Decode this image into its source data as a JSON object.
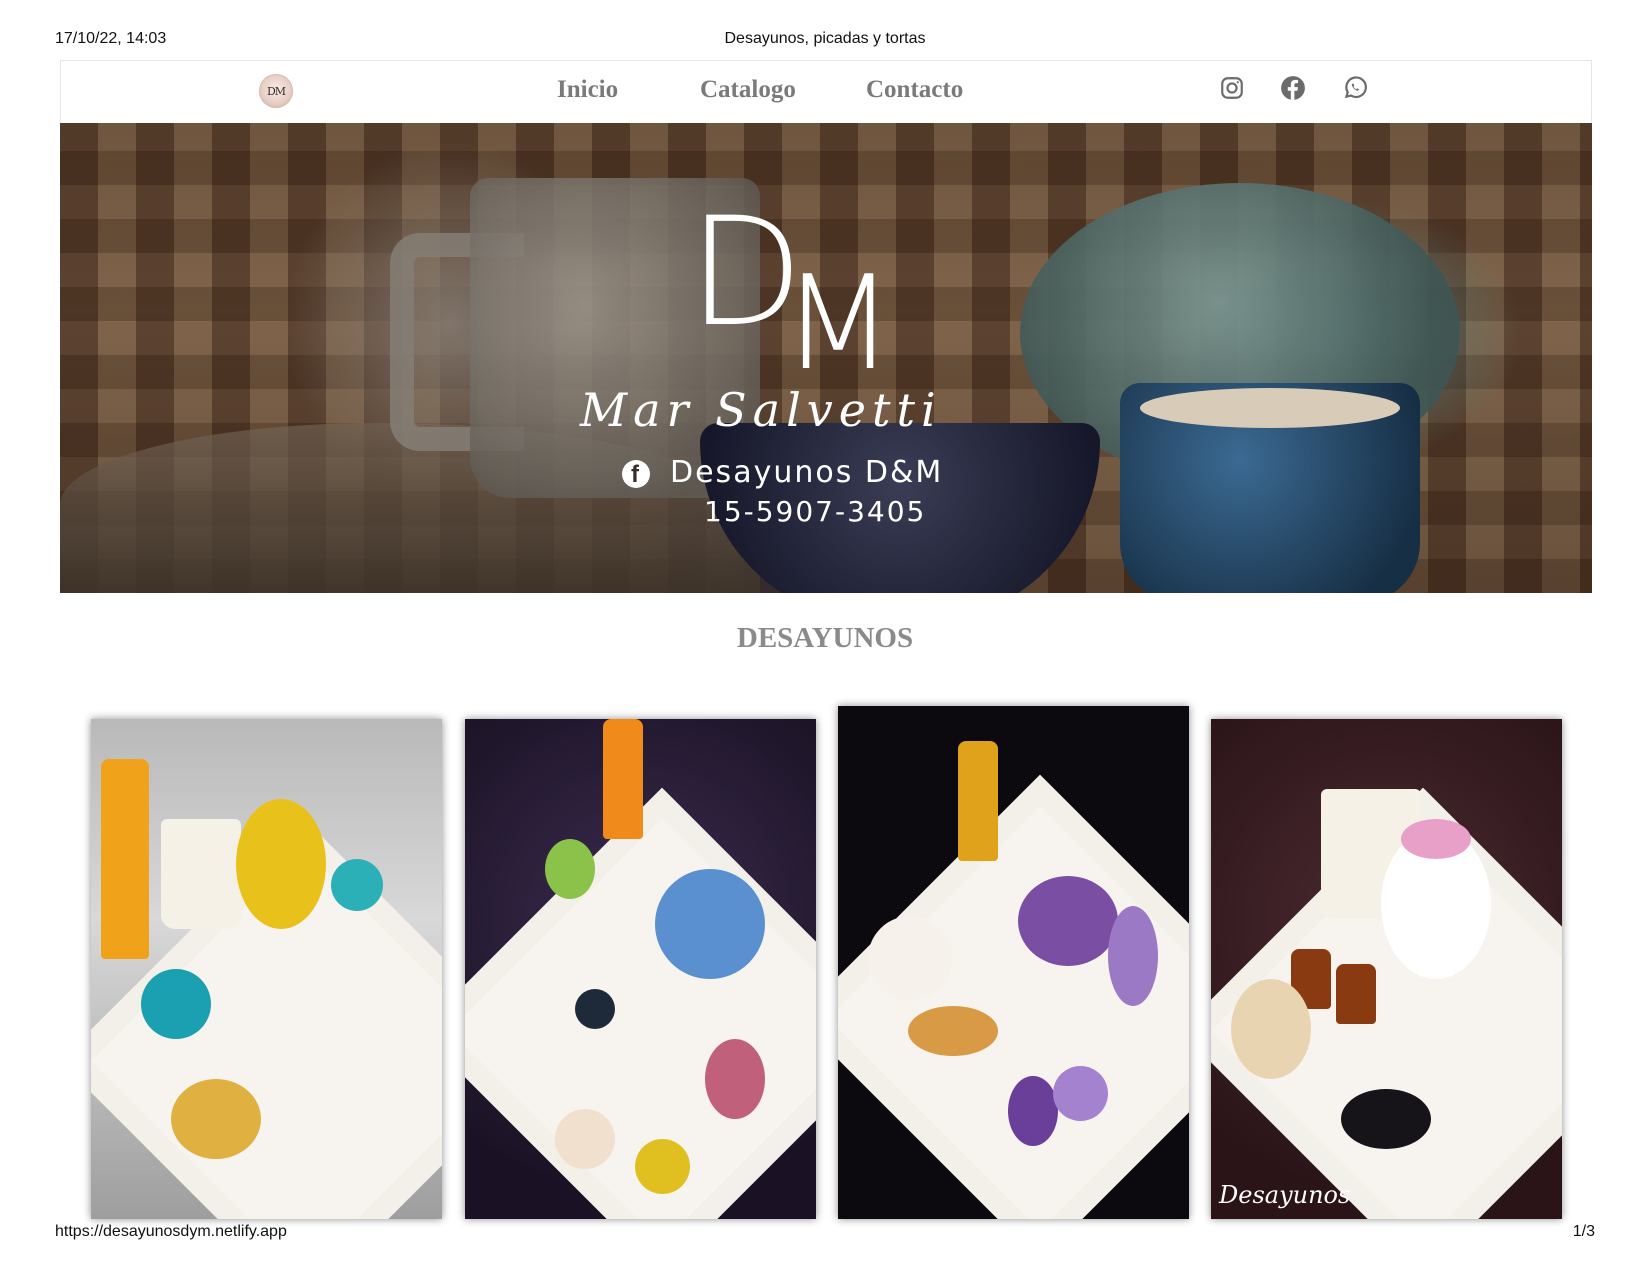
{
  "print_header": {
    "datetime": "17/10/22, 14:03",
    "title": "Desayunos, picadas y tortas"
  },
  "navbar": {
    "logo_text": "DM",
    "links": [
      {
        "label": "Inicio"
      },
      {
        "label": "Catalogo"
      },
      {
        "label": "Contacto"
      }
    ],
    "social_icons": [
      "instagram-icon",
      "facebook-icon",
      "whatsapp-icon"
    ],
    "link_color": "#7a7a7a",
    "icon_color": "#6b6b6b"
  },
  "hero": {
    "logo_letter_d": "D",
    "logo_letter_m": "M",
    "script_name": "Mar Salvetti",
    "facebook_icon_glyph": "f",
    "facebook_page": "Desayunos D&M",
    "phone": "15-5907-3405"
  },
  "section": {
    "title": "DESAYUNOS",
    "title_color": "#8a8a8a"
  },
  "products": [
    {
      "name": "desayuno-minions",
      "background": "#c9c9c9",
      "accent": "#1aa0b0"
    },
    {
      "name": "desayuno-tiktok",
      "background": "#2a1e36",
      "accent": "#e63e8f"
    },
    {
      "name": "desayuno-frozen",
      "background": "#0c0a0e",
      "accent": "#7a4fa3"
    },
    {
      "name": "desayuno-gatito",
      "background": "#3a1e22",
      "accent": "#e9a0c8",
      "watermark": "Desayunos"
    }
  ],
  "print_footer": {
    "url": "https://desayunosdym.netlify.app",
    "page": "1/3"
  }
}
